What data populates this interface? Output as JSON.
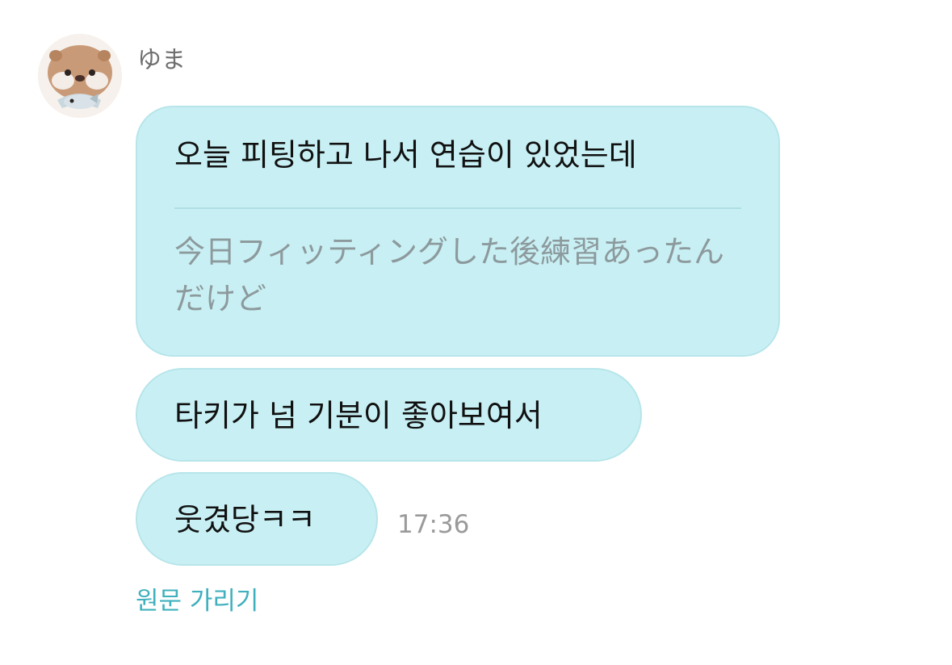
{
  "sender": {
    "name": "ゆま",
    "avatar_icon": "otter-avatar-icon"
  },
  "messages": [
    {
      "text": "오늘 피팅하고 나서 연습이 있었는데",
      "translation": "今日フィッティングした後練習あったんだけど"
    },
    {
      "text": "타키가 넘 기분이 좋아보여서"
    },
    {
      "text": "웃겼당ㅋㅋ",
      "time": "17:36"
    }
  ],
  "actions": {
    "hide_original": "원문 가리기"
  },
  "colors": {
    "bubble": "#c8f0f4",
    "bubble_border": "#b7e5ea",
    "accent_link": "#3fb0bd",
    "translation_text": "#8d9a9d"
  }
}
